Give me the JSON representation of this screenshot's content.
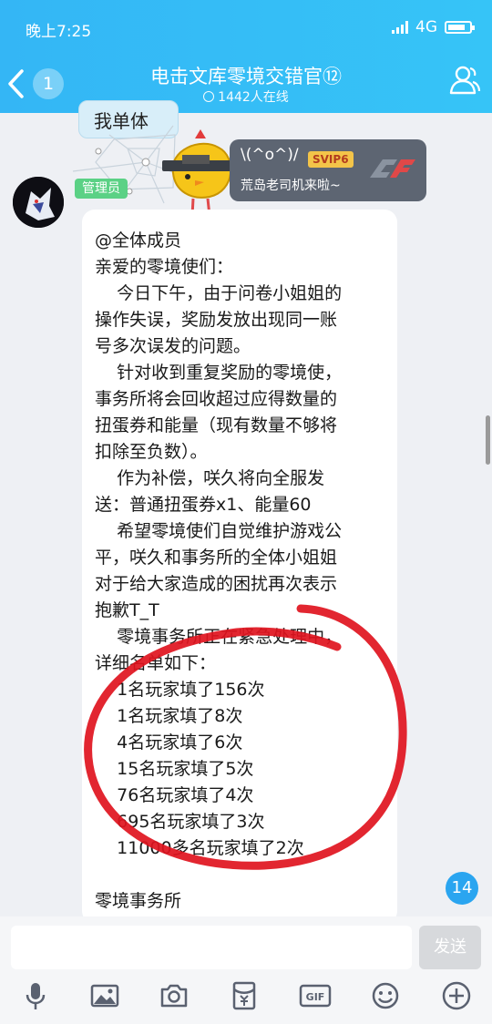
{
  "status_bar": {
    "time": "晚上7:25",
    "network": "4G"
  },
  "header": {
    "back_count": "1",
    "title": "电击文库零境交错官⑫",
    "online": "1442人在线"
  },
  "previous_message": {
    "text": "我单体"
  },
  "sender": {
    "role": "管理员"
  },
  "banner": {
    "kaomoji": "\\(^o^)/",
    "vip": "SVIP6",
    "subtitle": "荒岛老司机来啦~"
  },
  "message": {
    "lines": [
      "@全体成员",
      "亲爱的零境使们：",
      "    今日下午，由于问卷小姐姐的",
      "操作失误，奖励发放出现同一账",
      "号多次误发的问题。",
      "    针对收到重复奖励的零境使，",
      "事务所将会回收超过应得数量的",
      "扭蛋券和能量（现有数量不够将",
      "扣除至负数）。",
      "    作为补偿，咲久将向全服发",
      "送：普通扭蛋券x1、能量60",
      "    希望零境使们自觉维护游戏公",
      "平，咲久和事务所的全体小姐姐",
      "对于给大家造成的困扰再次表示",
      "抱歉T_T",
      "    零境事务所正在紧急处理中，",
      "详细名单如下：",
      "    1名玩家填了156次",
      "    1名玩家填了8次",
      "    4名玩家填了6次",
      "    15名玩家填了5次",
      "    76名玩家填了4次",
      "    695名玩家填了3次",
      "    11000多名玩家填了2次",
      "",
      "零境事务所"
    ]
  },
  "unread_count": "14",
  "input_bar": {
    "send_label": "发送"
  },
  "tools": [
    "microphone-icon",
    "image-icon",
    "camera-icon",
    "red-packet-icon",
    "gif-icon",
    "emoji-icon",
    "plus-icon"
  ],
  "colors": {
    "header": "#34b6f5",
    "admin_badge": "#5bd185",
    "unread": "#2aa5f0",
    "annotation": "#e0141e"
  }
}
